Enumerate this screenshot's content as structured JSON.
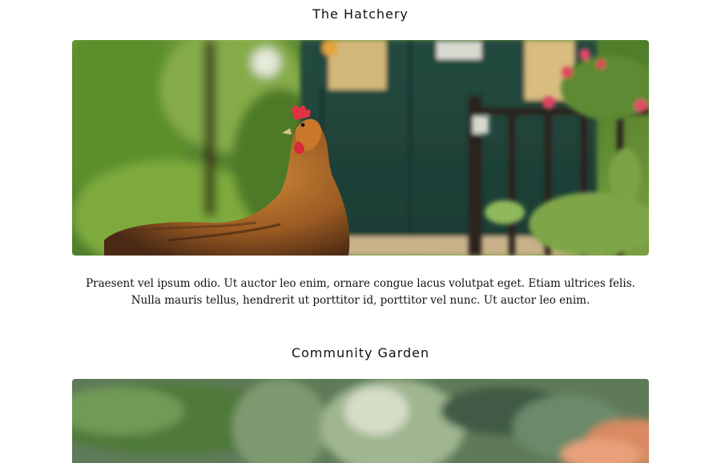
{
  "sections": [
    {
      "title": "The Hatchery",
      "image_alt": "Chicken in front of a green shed",
      "description": "Praesent vel ipsum odio. Ut auctor leo enim, ornare congue lacus volutpat eget. Etiam ultrices felis. Nulla mauris tellus, hendrerit ut porttitor id, porttitor vel nunc. Ut auctor leo enim."
    },
    {
      "title": "Community Garden",
      "image_alt": "Fresh vegetables at a market"
    }
  ]
}
